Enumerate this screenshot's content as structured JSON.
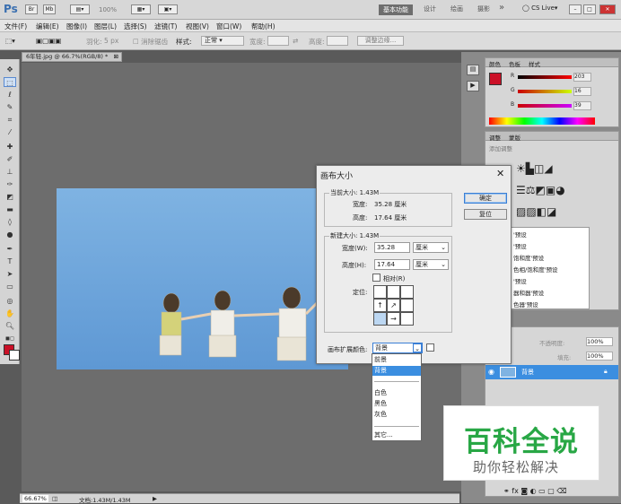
{
  "app": {
    "logo": "Ps",
    "zoom": "100%",
    "workspace_active": "基本功能",
    "workspace_items": [
      "设计",
      "绘画",
      "摄影"
    ],
    "more": "»",
    "cslive": "CS Live"
  },
  "menu": [
    "文件(F)",
    "编辑(E)",
    "图像(I)",
    "图层(L)",
    "选择(S)",
    "滤镜(T)",
    "视图(V)",
    "窗口(W)",
    "帮助(H)"
  ],
  "options": {
    "feather_label": "羽化:",
    "feather_value": "5 px",
    "antialias": "消除锯齿",
    "style_label": "样式:",
    "style_value": "正常",
    "width_label": "宽度:",
    "height_label": "高度:",
    "refine": "调整边缘..."
  },
  "document": {
    "tab": "6年轻.jpg @ 66.7%(RGB/8) *",
    "close": "⊠"
  },
  "status": {
    "zoom": "66.67%",
    "doc": "文档:1.43M/1.43M"
  },
  "color_panel": {
    "tabs": [
      "颜色",
      "色板",
      "样式"
    ],
    "r": "203",
    "g": "16",
    "b": "39",
    "r_label": "R",
    "g_label": "G",
    "b_label": "B",
    "swatch": "#cb1027"
  },
  "adjust_panel": {
    "tabs": [
      "调整",
      "蒙版"
    ],
    "title": "添加调整",
    "presets": [
      "'预设",
      "'预设",
      "饱和度'预设",
      "色相/饱和度'预设",
      "'预设",
      "器和器'预设",
      "色器'预设"
    ]
  },
  "layers_panel": {
    "opacity_label": "不透明度:",
    "opacity": "100%",
    "fill_label": "填充:",
    "fill": "100%",
    "layer_name": "背景"
  },
  "dialog": {
    "title": "画布大小",
    "close": "✕",
    "current_legend": "当前大小: 1.43M",
    "width_label": "宽度:",
    "width_value": "35.28 厘米",
    "height_label": "高度:",
    "height_value": "17.64 厘米",
    "new_legend": "新建大小: 1.43M",
    "new_width_label": "宽度(W):",
    "new_width": "35.28",
    "unit_w": "厘米",
    "new_height_label": "高度(H):",
    "new_height": "17.64",
    "unit_h": "厘米",
    "relative": "相对(R)",
    "anchor_label": "定位:",
    "ok": "确定",
    "reset": "复位",
    "ext_label": "画布扩展颜色:",
    "ext_value": "背景"
  },
  "dropdown": [
    "前景",
    "背景",
    "白色",
    "黑色",
    "灰色",
    "其它..."
  ],
  "watermark": {
    "big": "百科全说",
    "small": "助你轻松解决"
  }
}
